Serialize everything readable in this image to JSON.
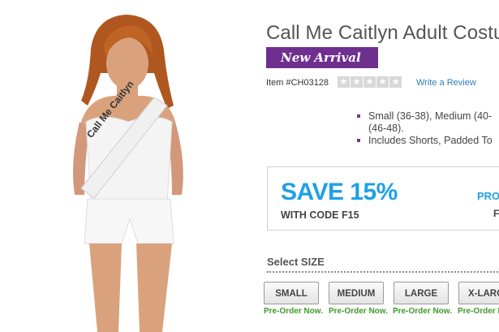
{
  "product": {
    "title": "Call Me Caitlyn Adult Costu",
    "badge": "New Arrival",
    "item_number": "Item #CH03128",
    "stars": [
      "★",
      "★",
      "★",
      "★",
      "★"
    ],
    "review_link": "Write a Review",
    "bullets": {
      "line1": "Small (36-38), Medium (40-",
      "line1_cont": "(46-48).",
      "line2": "Includes Shorts, Padded To"
    },
    "sash_text": "Call Me Caitlyn"
  },
  "promo": {
    "headline": "SAVE 15%",
    "code": "WITH CODE F15",
    "side": "PRO",
    "side2": "F"
  },
  "sizes": {
    "label": "Select SIZE",
    "options": [
      "SMALL",
      "MEDIUM",
      "LARGE",
      "X-LARG"
    ],
    "status": "Pre-Order Now.",
    "status_partial": "Pre-Order N"
  },
  "colors": {
    "brand_purple": "#6f2f8f",
    "promo_blue": "#1ea0e8",
    "link_blue": "#2a7fc0",
    "preorder_green": "#3f9a2a"
  }
}
